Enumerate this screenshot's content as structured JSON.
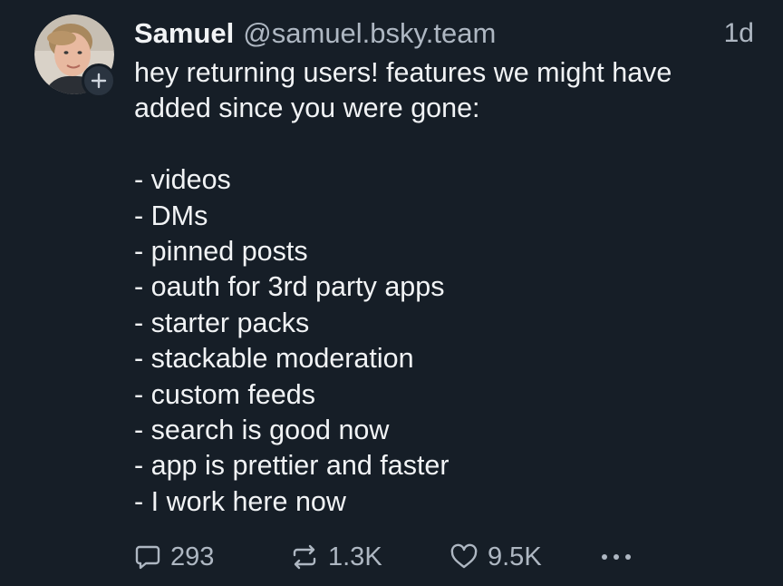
{
  "post": {
    "author": {
      "display_name": "Samuel",
      "handle": "@samuel.bsky.team",
      "avatar_icon": "person-avatar",
      "follow_icon": "plus-icon"
    },
    "timestamp": "1d",
    "text": {
      "line_1": "hey returning users! features we might have",
      "line_2": "added since you were gone:",
      "list": [
        "- videos",
        "- DMs",
        "- pinned posts",
        "- oauth for 3rd party apps",
        "- starter packs",
        "- stackable moderation",
        "- custom feeds",
        "- search is good now",
        "- app is prettier and faster",
        "- I work here now"
      ]
    },
    "actions": {
      "reply_count": "293",
      "repost_count": "1.3K",
      "like_count": "9.5K",
      "reply_icon": "speech-bubble-icon",
      "repost_icon": "repost-arrows-icon",
      "like_icon": "heart-icon",
      "more_icon": "ellipsis-icon"
    }
  },
  "colors": {
    "background": "#161e27",
    "text_primary": "#f1f3f5",
    "text_secondary": "#aeb7c2",
    "badge_background": "#2a3440"
  }
}
